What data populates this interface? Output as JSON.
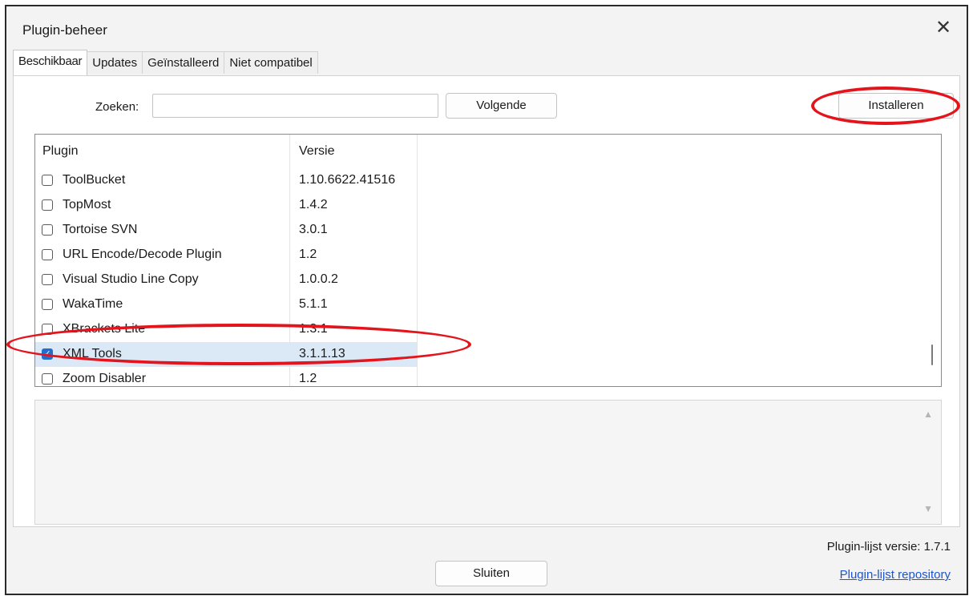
{
  "window": {
    "title": "Plugin-beheer"
  },
  "tabs": [
    {
      "label": "Beschikbaar",
      "active": true
    },
    {
      "label": "Updates"
    },
    {
      "label": "Geïnstalleerd"
    },
    {
      "label": "Niet compatibel"
    }
  ],
  "search": {
    "label": "Zoeken:",
    "value": "",
    "placeholder": ""
  },
  "buttons": {
    "next": "Volgende",
    "install": "Installeren",
    "close": "Sluiten"
  },
  "list": {
    "headers": {
      "plugin": "Plugin",
      "version": "Versie"
    },
    "rows": [
      {
        "name": "ToolBucket",
        "version": "1.10.6622.41516",
        "checked": false
      },
      {
        "name": "TopMost",
        "version": "1.4.2",
        "checked": false
      },
      {
        "name": "Tortoise SVN",
        "version": "3.0.1",
        "checked": false
      },
      {
        "name": "URL Encode/Decode Plugin",
        "version": "1.2",
        "checked": false
      },
      {
        "name": "Visual Studio Line Copy",
        "version": "1.0.0.2",
        "checked": false
      },
      {
        "name": "WakaTime",
        "version": "5.1.1",
        "checked": false
      },
      {
        "name": "XBrackets Lite",
        "version": "1.3.1",
        "checked": false
      },
      {
        "name": "XML Tools",
        "version": "3.1.1.13",
        "checked": true,
        "selected": true
      },
      {
        "name": "Zoom Disabler",
        "version": "1.2",
        "checked": false
      }
    ]
  },
  "description": {
    "text": ""
  },
  "footer": {
    "list_version": "Plugin-lijst versie:  1.7.1",
    "repo_link": "Plugin-lijst repository"
  },
  "colors": {
    "annotation": "#e3141b",
    "selection": "#dbe9f7",
    "link": "#1a55d4",
    "checkbox": "#1f6fd0"
  },
  "icons": {
    "close": "close-icon",
    "scroll_up": "scroll-up-arrow-icon",
    "scroll_down": "scroll-down-arrow-icon",
    "check": "checkmark-icon"
  }
}
